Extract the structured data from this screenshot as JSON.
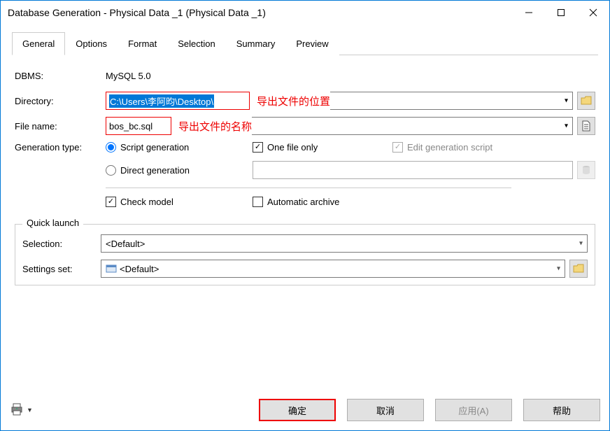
{
  "window": {
    "title": "Database Generation - Physical Data _1 (Physical Data _1)"
  },
  "tabs": [
    "General",
    "Options",
    "Format",
    "Selection",
    "Summary",
    "Preview"
  ],
  "general": {
    "dbms_label": "DBMS:",
    "dbms_value": "MySQL 5.0",
    "directory_label": "Directory:",
    "directory_value": "C:\\Users\\李阿昀\\Desktop\\",
    "directory_annotation": "导出文件的位置",
    "filename_label": "File name:",
    "filename_value": "bos_bc.sql",
    "filename_annotation": "导出文件的名称",
    "gentype_label": "Generation type:",
    "script_gen": "Script generation",
    "direct_gen": "Direct generation",
    "one_file": "One file only",
    "edit_script": "Edit generation script",
    "check_model": "Check model",
    "auto_archive": "Automatic archive"
  },
  "quick_launch": {
    "legend": "Quick launch",
    "selection_label": "Selection:",
    "selection_value": "<Default>",
    "settings_label": "Settings set:",
    "settings_value": "<Default>"
  },
  "buttons": {
    "ok": "确定",
    "cancel": "取消",
    "apply": "应用(A)",
    "help": "帮助"
  }
}
